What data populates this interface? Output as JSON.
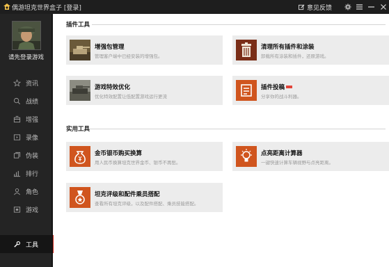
{
  "window": {
    "title": "偶游坦克世界盒子 [登录]"
  },
  "toolbar": {
    "feedback": "意见反馈"
  },
  "user": {
    "login_prompt": "请先登录游戏"
  },
  "nav": [
    {
      "label": "资讯",
      "icon": "star-icon"
    },
    {
      "label": "战绩",
      "icon": "search-icon"
    },
    {
      "label": "增强",
      "icon": "box-icon"
    },
    {
      "label": "录像",
      "icon": "video-icon"
    },
    {
      "label": "伪装",
      "icon": "camouflage-icon"
    },
    {
      "label": "排行",
      "icon": "bar-chart-icon"
    },
    {
      "label": "角色",
      "icon": "person-icon"
    },
    {
      "label": "游戏",
      "icon": "game-icon"
    },
    {
      "label": "工具",
      "icon": "wrench-icon",
      "active": true
    }
  ],
  "sections": {
    "plugins": "插件工具",
    "utilities": "实用工具"
  },
  "cards": {
    "enhance": {
      "title": "增强包管理",
      "desc": "管理客户端中已经安装的增强包。"
    },
    "cleanup": {
      "title": "清理所有插件和涂装",
      "desc": "卸载所有涂装和插件，还原游戏。"
    },
    "effects": {
      "title": "游戏特效优化",
      "desc": "优化特效配置让低配置游戏运行更流"
    },
    "submit": {
      "title": "插件投稿",
      "desc": "分享你的战斗利器。"
    },
    "gold": {
      "title": "金币银币购买换算",
      "desc": "用人民币换算坦克世界金币、银币不再愁。"
    },
    "spot": {
      "title": "点亮距离计算器",
      "desc": "一键快速计算车辆视野与点亮距离。"
    },
    "tank": {
      "title": "坦克评级和配件乘员搭配",
      "desc": "查看所有坦克评级，以及配件搭配、乘员技能搭配。"
    }
  },
  "colors": {
    "accent": "#d02a1e",
    "sidebar": "#242424",
    "titlebar": "#1e1e1e",
    "icon_orange": "#d0551e"
  }
}
